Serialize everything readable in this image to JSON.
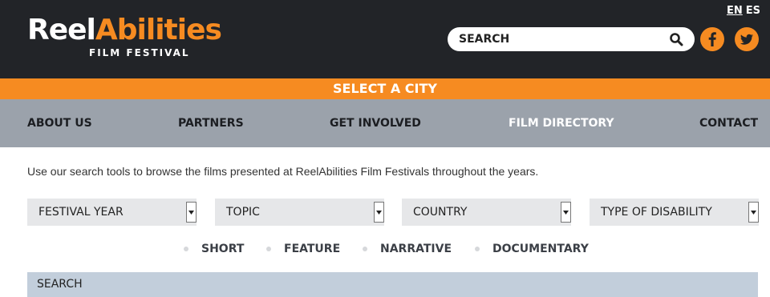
{
  "header": {
    "logo": {
      "part1": "Reel",
      "part2": "Abilities",
      "subtitle": "FILM FESTIVAL"
    },
    "languages": [
      "EN",
      "ES"
    ],
    "search": {
      "placeholder": "SEARCH",
      "value": ""
    },
    "social": [
      "facebook-icon",
      "twitter-icon"
    ]
  },
  "city_bar": {
    "label": "SELECT A CITY"
  },
  "nav": {
    "items": [
      "ABOUT US",
      "PARTNERS",
      "GET INVOLVED",
      "FILM DIRECTORY",
      "CONTACT"
    ],
    "active": "FILM DIRECTORY"
  },
  "intro": "Use our search tools to browse the films presented at ReelAbilities Film Festivals throughout the years.",
  "filters": [
    "FESTIVAL YEAR",
    "TOPIC",
    "COUNTRY",
    "TYPE OF DISABILITY"
  ],
  "types": [
    "SHORT",
    "FEATURE",
    "NARRATIVE",
    "DOCUMENTARY"
  ],
  "search_bar": {
    "label": "SEARCH"
  },
  "colors": {
    "header_bg": "#222428",
    "accent": "#f68b21",
    "nav_bg": "#9ba2ab",
    "search_bar_bg": "#c2cedb",
    "select_bg": "#e6e7e9"
  }
}
